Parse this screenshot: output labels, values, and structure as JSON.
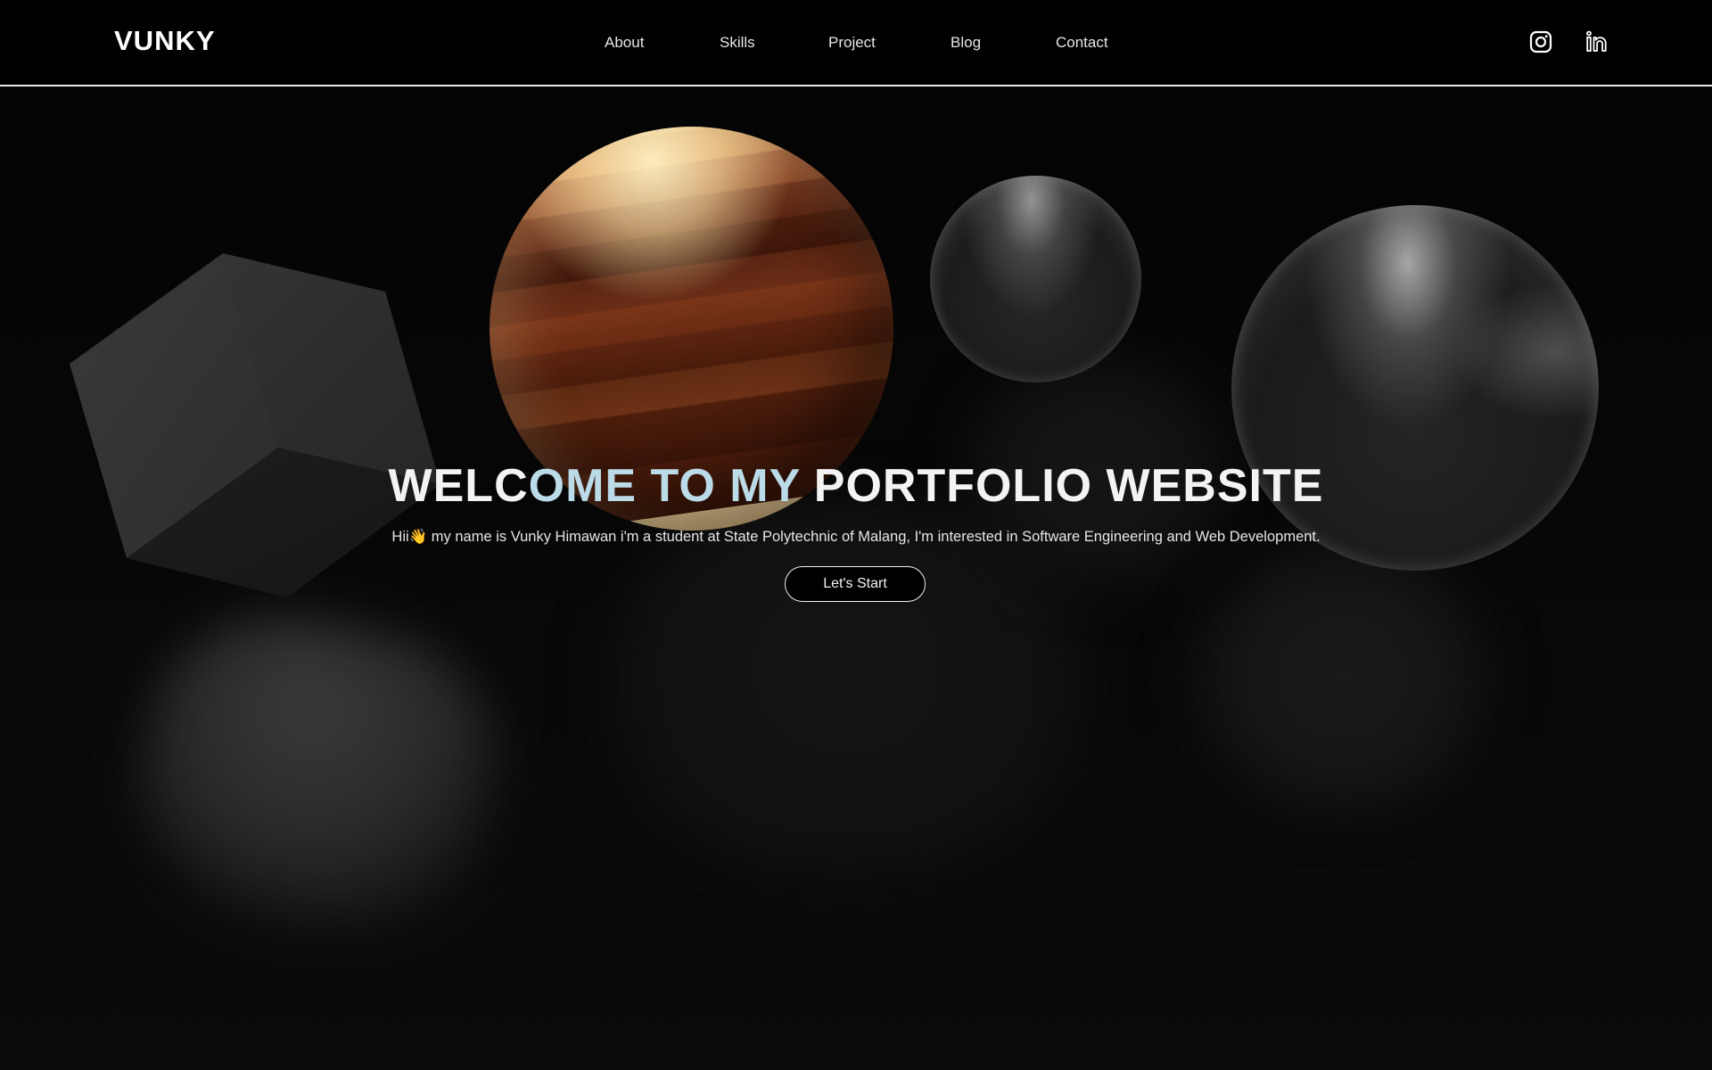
{
  "brand": "VUNKY",
  "nav": {
    "items": [
      {
        "label": "About"
      },
      {
        "label": "Skills"
      },
      {
        "label": "Project"
      },
      {
        "label": "Blog"
      },
      {
        "label": "Contact"
      }
    ]
  },
  "social": {
    "instagram_icon": "instagram-icon",
    "linkedin_icon": "linkedin-icon"
  },
  "hero": {
    "title_part1": "WELC",
    "title_accent": "OME TO MY",
    "title_part2": " PORTFOLIO WEBSITE",
    "subtitle_pre": "Hii",
    "subtitle_emoji": "👋",
    "subtitle_post": " my name is Vunky Himawan i'm a student at State Polytechnic of Malang, I'm interested in Software Engineering and Web Development.",
    "cta_label": "Let's Start"
  },
  "colors": {
    "background": "#000000",
    "accent_text": "#bcdbe8",
    "planet": "#c88450"
  }
}
